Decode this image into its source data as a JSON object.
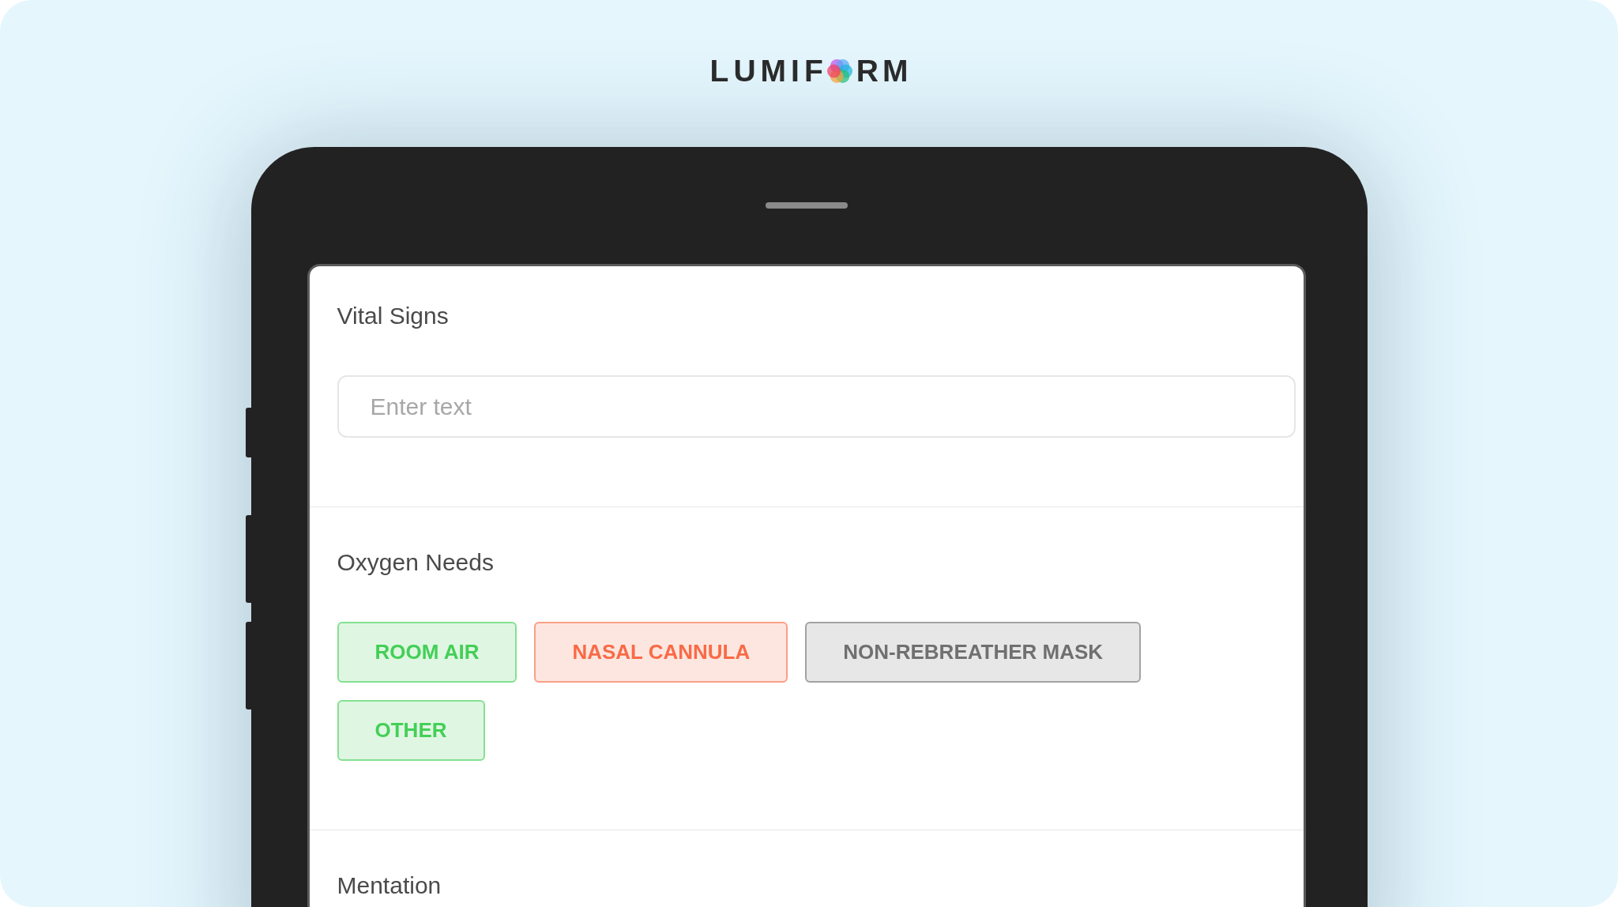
{
  "logo": {
    "text_before_mark": "LUMIF",
    "text_after_mark": "RM"
  },
  "sections": [
    {
      "kind": "text",
      "title": "Vital Signs",
      "placeholder": "Enter text"
    },
    {
      "kind": "choice",
      "title": "Oxygen Needs",
      "options": [
        {
          "label": "ROOM AIR",
          "color": "#44cf57"
        },
        {
          "label": "NASAL CANNULA",
          "color": "#f86b46"
        },
        {
          "label": "NON-REBREATHER MASK",
          "color": "#707070"
        },
        {
          "label": "OTHER",
          "color": "#44cf57"
        }
      ]
    },
    {
      "kind": "heading",
      "title": "Mentation"
    }
  ]
}
